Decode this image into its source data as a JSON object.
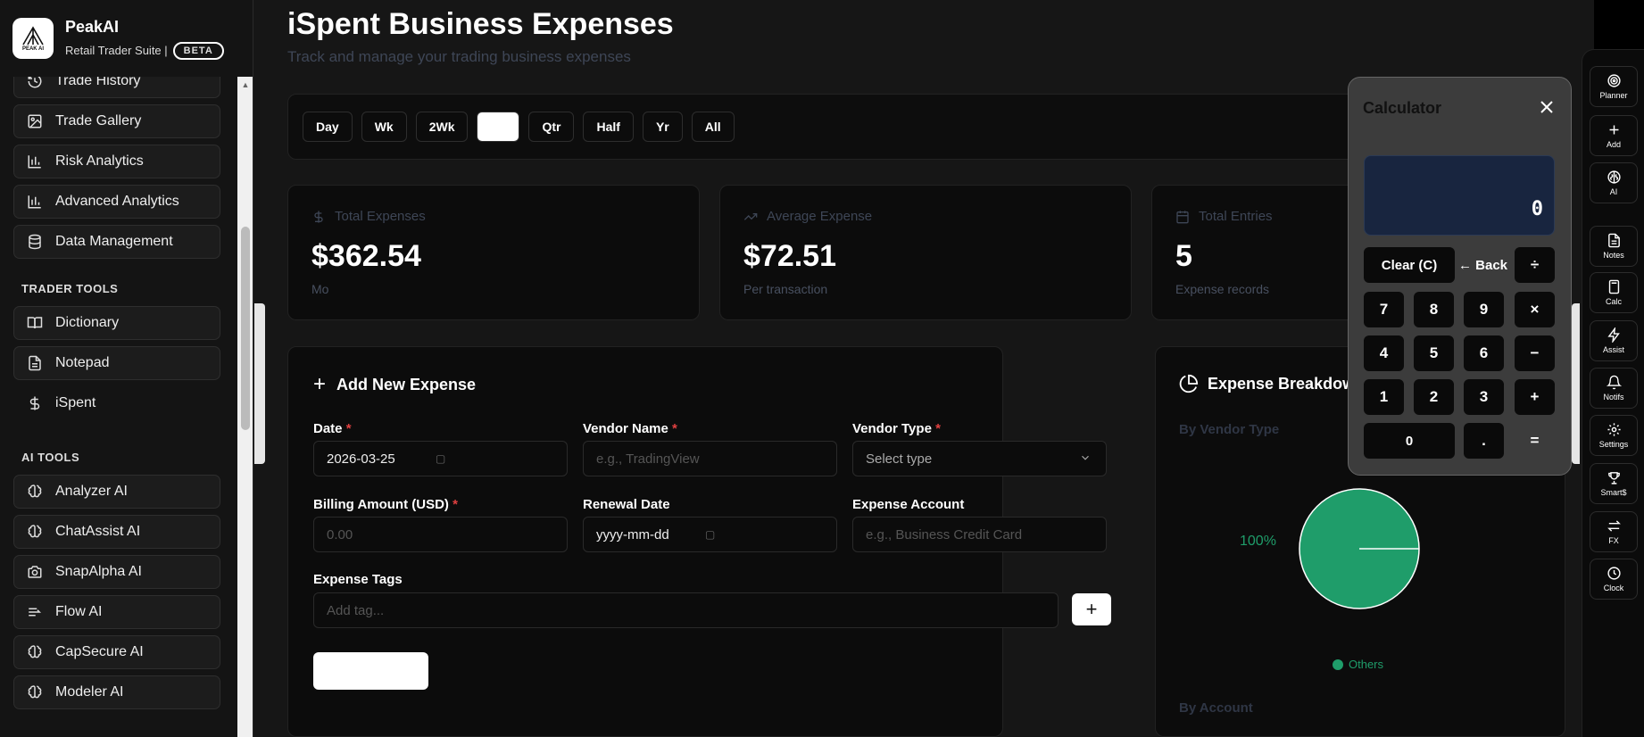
{
  "brand": {
    "name": "PeakAI",
    "logo_text": "PEAK AI",
    "subtitle": "Retail Trader Suite |",
    "badge": "BETA"
  },
  "sidebar": {
    "analytics_items": [
      {
        "label": "Trade History",
        "icon": "history-icon"
      },
      {
        "label": "Trade Gallery",
        "icon": "gallery-icon"
      },
      {
        "label": "Risk Analytics",
        "icon": "bar-chart-icon"
      },
      {
        "label": "Advanced Analytics",
        "icon": "bar-chart-icon"
      },
      {
        "label": "Data Management",
        "icon": "database-icon"
      }
    ],
    "trader_tools_title": "TRADER TOOLS",
    "trader_tools": [
      {
        "label": "Dictionary",
        "icon": "book-icon"
      },
      {
        "label": "Notepad",
        "icon": "notepad-icon"
      },
      {
        "label": "iSpent",
        "icon": "dollar-icon"
      }
    ],
    "ai_tools_title": "AI TOOLS",
    "ai_tools": [
      {
        "label": "Analyzer AI",
        "icon": "brain-icon"
      },
      {
        "label": "ChatAssist AI",
        "icon": "brain-icon"
      },
      {
        "label": "SnapAlpha AI",
        "icon": "camera-icon"
      },
      {
        "label": "Flow AI",
        "icon": "flow-icon"
      },
      {
        "label": "CapSecure AI",
        "icon": "brain-icon"
      },
      {
        "label": "Modeler AI",
        "icon": "brain-icon"
      }
    ]
  },
  "page": {
    "title": "iSpent Business Expenses",
    "subtitle": "Track and manage your trading business expenses"
  },
  "periods": [
    "Day",
    "Wk",
    "2Wk",
    "",
    "Qtr",
    "Half",
    "Yr",
    "All"
  ],
  "stats": {
    "total": {
      "label": "Total Expenses",
      "value": "$362.54",
      "note": "Mo"
    },
    "average": {
      "label": "Average Expense",
      "value": "$72.51",
      "note": "Per transaction"
    },
    "entries": {
      "label": "Total Entries",
      "value": "5",
      "note": "Expense records"
    }
  },
  "form": {
    "title": "Add New Expense",
    "date_label": "Date",
    "date_value": "2026-03-25",
    "vendor_label": "Vendor Name",
    "vendor_placeholder": "e.g., TradingView",
    "type_label": "Vendor Type",
    "type_placeholder": "Select type",
    "amount_label": "Billing Amount (USD)",
    "amount_placeholder": "0.00",
    "renewal_label": "Renewal Date",
    "renewal_placeholder": "yyyy-mm-dd",
    "account_label": "Expense Account",
    "account_placeholder": "e.g., Business Credit Card",
    "tags_label": "Expense Tags",
    "tags_placeholder": "Add tag...",
    "required_mark": "*"
  },
  "breakdown": {
    "title": "Expense Breakdown",
    "by_vendor": "By Vendor Type",
    "by_account": "By Account"
  },
  "chart_data": {
    "type": "pie",
    "categories": [
      "Others"
    ],
    "values": [
      100
    ],
    "labels": [
      "100%"
    ],
    "colors": [
      "#1f9d6a"
    ]
  },
  "calculator": {
    "title": "Calculator",
    "display": "0",
    "keys": {
      "clear": "Clear (C)",
      "back": "← Back",
      "divide": "÷",
      "seven": "7",
      "eight": "8",
      "nine": "9",
      "multiply": "×",
      "four": "4",
      "five": "5",
      "six": "6",
      "minus": "−",
      "one": "1",
      "two": "2",
      "three": "3",
      "plus": "+",
      "zero": "0",
      "dot": ".",
      "equals": "="
    }
  },
  "dock": [
    "Planner",
    "Add",
    "AI",
    "Notes",
    "Calc",
    "Assist",
    "Notifs",
    "Settings",
    "Smart$",
    "FX",
    "Clock"
  ]
}
